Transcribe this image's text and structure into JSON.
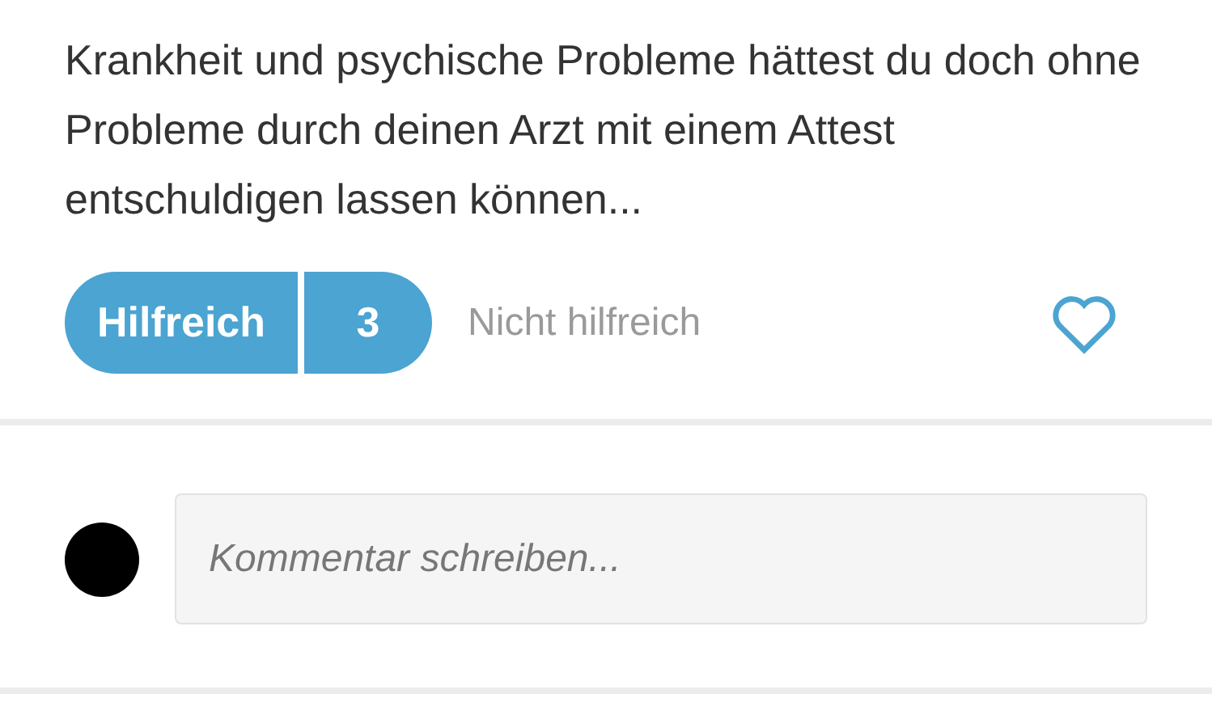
{
  "answer": {
    "text": "Krankheit und psychische Probleme hättest du doch ohne Probleme durch deinen Arzt mit einem Attest entschuldigen lassen können..."
  },
  "actions": {
    "helpful": "Hilfreich",
    "helpful_count": "3",
    "not_helpful": "Nicht hilfreich"
  },
  "comment": {
    "placeholder": "Kommentar schreiben..."
  }
}
